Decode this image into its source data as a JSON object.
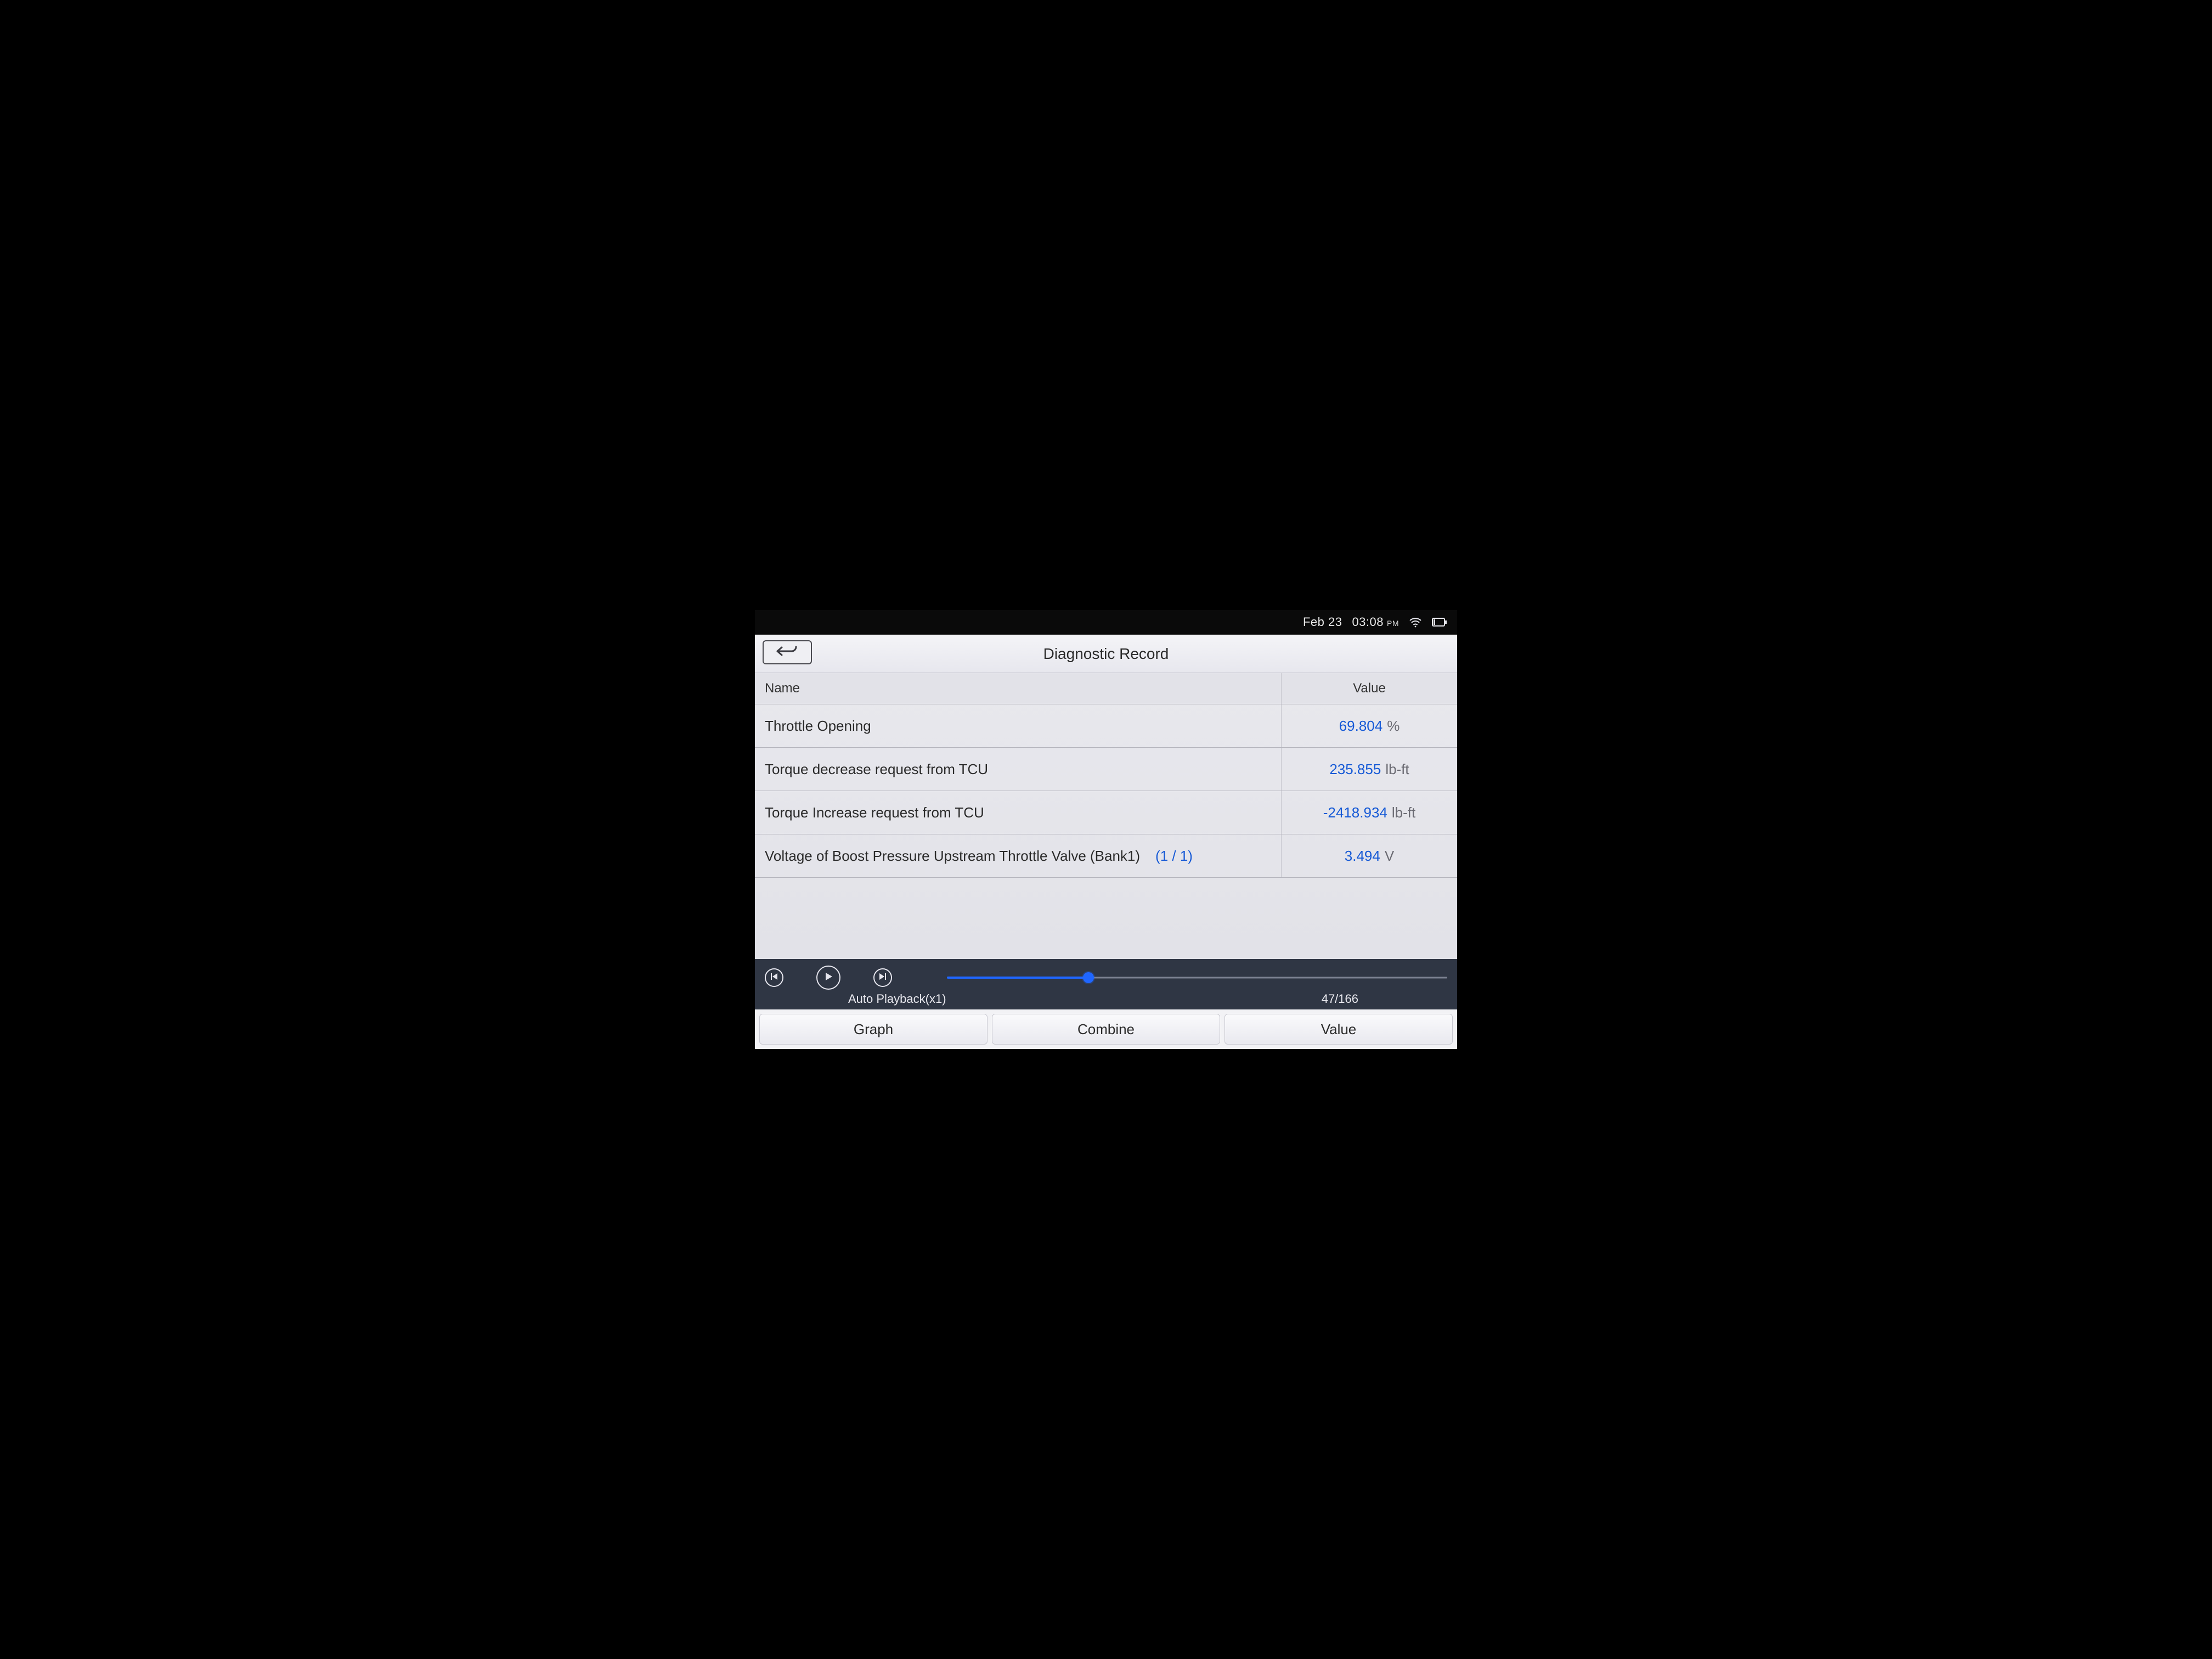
{
  "status": {
    "date": "Feb 23",
    "time": "03:08",
    "ampm": "PM"
  },
  "header": {
    "title": "Diagnostic Record"
  },
  "columns": {
    "name": "Name",
    "value": "Value"
  },
  "rows": [
    {
      "name": "Throttle Opening",
      "value": "69.804",
      "unit": "%",
      "sub": ""
    },
    {
      "name": "Torque decrease request from TCU",
      "value": "235.855",
      "unit": "lb-ft",
      "sub": ""
    },
    {
      "name": "Torque Increase request from TCU",
      "value": "-2418.934",
      "unit": "lb-ft",
      "sub": ""
    },
    {
      "name": "Voltage of Boost Pressure Upstream Throttle Valve (Bank1)",
      "value": "3.494",
      "unit": "V",
      "sub": "(1 / 1)"
    }
  ],
  "playback": {
    "label": "Auto Playback(x1)",
    "position": 47,
    "total": 166,
    "counter": "47/166",
    "percent": 28.3
  },
  "tabs": {
    "graph": "Graph",
    "combine": "Combine",
    "value": "Value"
  }
}
